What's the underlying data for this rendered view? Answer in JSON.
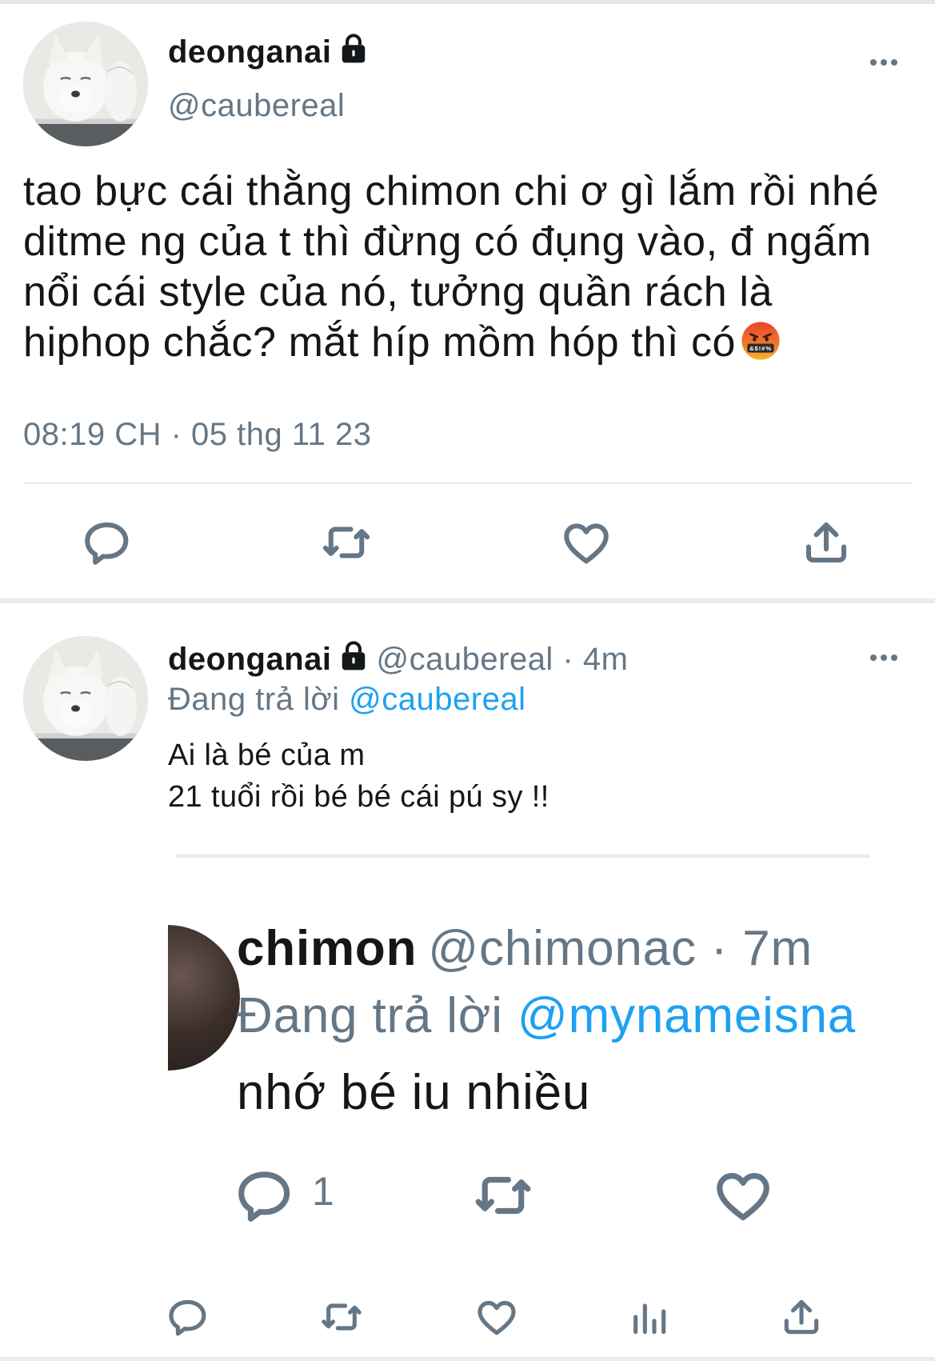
{
  "main_tweet": {
    "display_name": "deonganai",
    "handle": "@caubereal",
    "text": "tao bực cái thằng chimon chi ơ gì lắm rồi nhé ditme ng của t thì đừng có đụng vào, đ ngấm nổi cái style của nó, tưởng quần rách là hiphop chắc? mắt híp mồm hóp thì có",
    "emoji": "cursing-face",
    "timestamp": "08:19 CH · 05 thg 11 23",
    "actions": [
      "reply-icon",
      "retweet-icon",
      "like-icon",
      "share-icon"
    ]
  },
  "reply_tweet": {
    "display_name": "deonganai",
    "handle_time": "@caubereal · 4m",
    "replying_prefix": "Đang trả lời",
    "replying_to": "@caubereal",
    "text_line1": "Ai là bé của m",
    "text_line2": "21 tuổi rồi bé bé cái pú sy !!",
    "actions": [
      "reply-icon",
      "retweet-icon",
      "like-icon",
      "analytics-icon",
      "share-icon"
    ]
  },
  "embedded_screenshot": {
    "display_name": "chimon",
    "handle_time": "@chimonac · 7m",
    "replying_prefix": "Đang trả lời",
    "replying_to": "@mynameisna",
    "text": "nhớ bé iu nhiều",
    "reply_count": "1"
  },
  "colors": {
    "text": "#14171a",
    "secondary": "#657786",
    "link": "#1da1f2",
    "divider": "#e6ecf0"
  }
}
